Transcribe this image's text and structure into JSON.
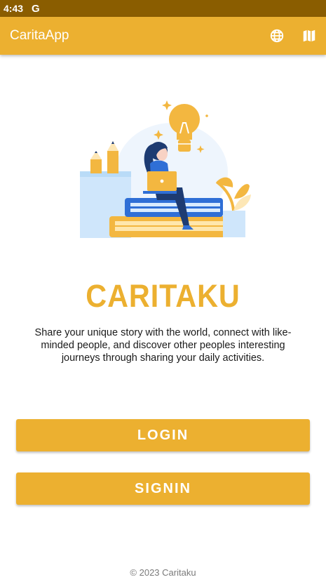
{
  "status_bar": {
    "time": "4:43",
    "google_badge": "G"
  },
  "app_bar": {
    "title": "CaritaApp",
    "globe_icon": "globe-icon",
    "map_icon": "map-icon"
  },
  "welcome": {
    "brand": "CARITAKU",
    "tagline": "Share your unique story with the world, connect with like-minded people, and discover other peoples interesting journeys through sharing your daily activities."
  },
  "buttons": {
    "login": "LOGIN",
    "signin": "SIGNIN"
  },
  "footer": {
    "copyright": "© 2023 Caritaku"
  },
  "colors": {
    "accent": "#ecb030",
    "status_bar": "#8a5d00",
    "illustration_blue": "#2f6fd6"
  }
}
